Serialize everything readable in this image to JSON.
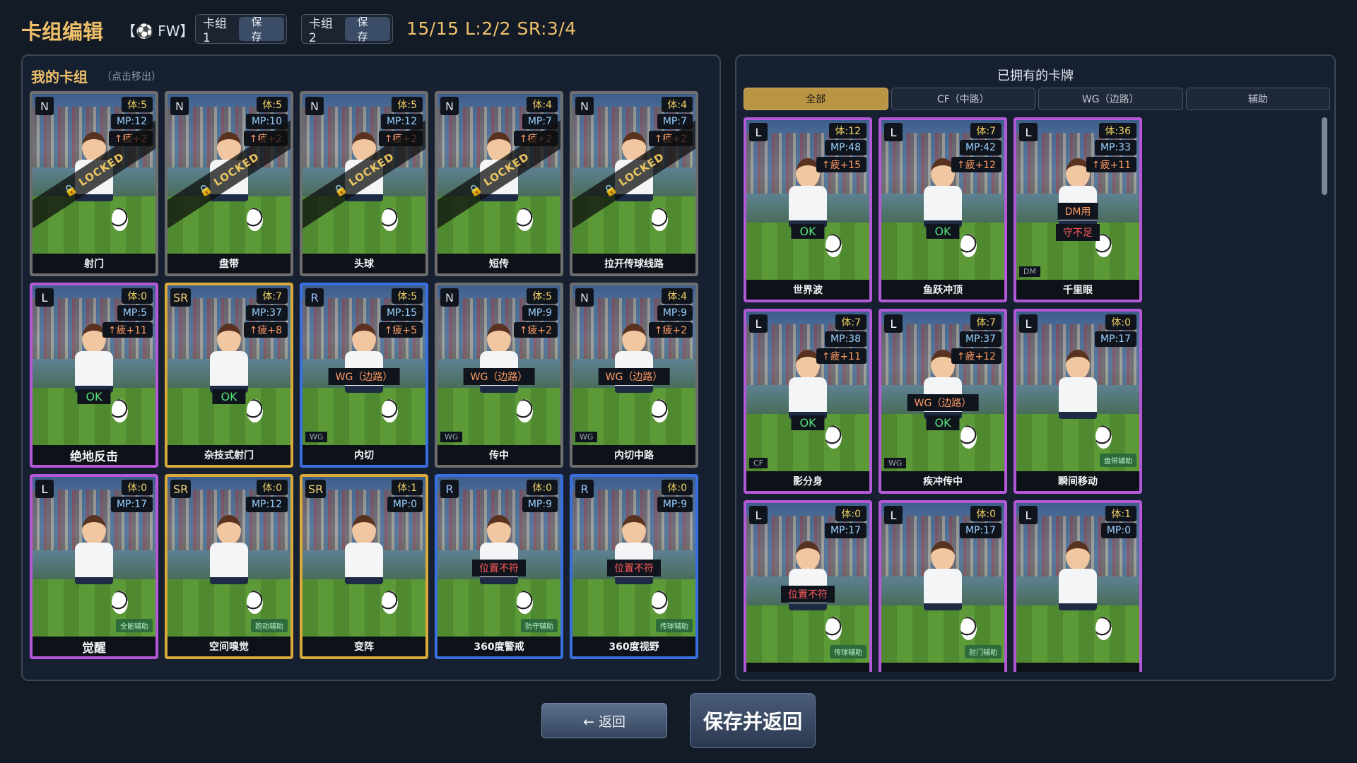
{
  "header": {
    "title": "卡组编辑",
    "role": "【⚽ FW】",
    "slots": [
      {
        "label": "卡组1",
        "save_label": "保存"
      },
      {
        "label": "卡组2",
        "save_label": "保存"
      }
    ],
    "deck_stats": "15/15  L:2/2  SR:3/4"
  },
  "my_deck": {
    "title": "我的卡组",
    "hint": "（点击移出）",
    "cards": [
      {
        "rarity": "N",
        "stamina": "体:5",
        "mp": "MP:12",
        "fatigue": "↑疲+2",
        "name": "射门",
        "overlay": "🔒 LOCKED"
      },
      {
        "rarity": "N",
        "stamina": "体:5",
        "mp": "MP:10",
        "fatigue": "↑疲+2",
        "name": "盘带",
        "overlay": "🔒 LOCKED"
      },
      {
        "rarity": "N",
        "stamina": "体:5",
        "mp": "MP:12",
        "fatigue": "↑疲+2",
        "name": "头球",
        "overlay": "🔒 LOCKED"
      },
      {
        "rarity": "N",
        "stamina": "体:4",
        "mp": "MP:7",
        "fatigue": "↑疲+2",
        "name": "短传",
        "overlay": "🔒 LOCKED"
      },
      {
        "rarity": "N",
        "stamina": "体:4",
        "mp": "MP:7",
        "fatigue": "↑疲+2",
        "name": "拉开传球线路",
        "overlay": "🔒 LOCKED"
      },
      {
        "rarity": "L",
        "stamina": "体:0",
        "mp": "MP:5",
        "fatigue": "↑疲+11",
        "name": "绝地反击",
        "ok": "OK"
      },
      {
        "rarity": "SR",
        "stamina": "体:7",
        "mp": "MP:37",
        "fatigue": "↑疲+8",
        "name": "杂技式射门",
        "ok": "OK"
      },
      {
        "rarity": "R",
        "stamina": "体:5",
        "mp": "MP:15",
        "fatigue": "↑疲+5",
        "name": "内切",
        "tag": "WG（边路）",
        "pos": "WG"
      },
      {
        "rarity": "N",
        "stamina": "体:5",
        "mp": "MP:9",
        "fatigue": "↑疲+2",
        "name": "传中",
        "tag": "WG（边路）",
        "pos": "WG"
      },
      {
        "rarity": "N",
        "stamina": "体:4",
        "mp": "MP:9",
        "fatigue": "↑疲+2",
        "name": "内切中路",
        "tag": "WG（边路）",
        "pos": "WG"
      },
      {
        "rarity": "L",
        "stamina": "体:0",
        "mp": "MP:17",
        "name": "觉醒",
        "support": "全能辅助"
      },
      {
        "rarity": "SR",
        "stamina": "体:0",
        "mp": "MP:12",
        "name": "空间嗅觉",
        "support": "跑动辅助"
      },
      {
        "rarity": "SR",
        "stamina": "体:1",
        "mp": "MP:0",
        "name": "变阵"
      },
      {
        "rarity": "R",
        "stamina": "体:0",
        "mp": "MP:9",
        "name": "360度警戒",
        "tag": "位置不符",
        "support": "防守辅助"
      },
      {
        "rarity": "R",
        "stamina": "体:0",
        "mp": "MP:9",
        "name": "360度视野",
        "tag": "位置不符",
        "support": "传球辅助"
      }
    ]
  },
  "owned": {
    "title": "已拥有的卡牌",
    "tabs": [
      "全部",
      "CF（中路）",
      "WG（边路）",
      "辅助"
    ],
    "active_tab": 0,
    "cards": [
      {
        "rarity": "L",
        "stamina": "体:12",
        "mp": "MP:48",
        "fatigue": "↑疲+15",
        "name": "世界波",
        "ok": "OK"
      },
      {
        "rarity": "L",
        "stamina": "体:7",
        "mp": "MP:42",
        "fatigue": "↑疲+12",
        "name": "鱼跃冲顶",
        "ok": "OK"
      },
      {
        "rarity": "L",
        "stamina": "体:36",
        "mp": "MP:33",
        "fatigue": "↑疲+11",
        "name": "千里眼",
        "tag": "DM用",
        "tag2": "守不足",
        "pos": "DM"
      },
      {
        "rarity": "L",
        "stamina": "体:7",
        "mp": "MP:38",
        "fatigue": "↑疲+11",
        "name": "影分身",
        "ok": "OK",
        "pos": "CF"
      },
      {
        "rarity": "L",
        "stamina": "体:7",
        "mp": "MP:37",
        "fatigue": "↑疲+12",
        "name": "疾冲传中",
        "tag": "WG（边路）",
        "ok": "OK",
        "pos": "WG"
      },
      {
        "rarity": "L",
        "stamina": "体:0",
        "mp": "MP:17",
        "name": "瞬间移动",
        "support": "盘带辅助"
      },
      {
        "rarity": "L",
        "stamina": "体:0",
        "mp": "MP:17",
        "name": "",
        "tag": "位置不符",
        "support": "传球辅助"
      },
      {
        "rarity": "L",
        "stamina": "体:0",
        "mp": "MP:17",
        "name": "",
        "support": "射门辅助"
      },
      {
        "rarity": "L",
        "stamina": "体:1",
        "mp": "MP:0",
        "name": ""
      }
    ]
  },
  "buttons": {
    "back": "← 返回",
    "save_return": "保存并返回"
  }
}
